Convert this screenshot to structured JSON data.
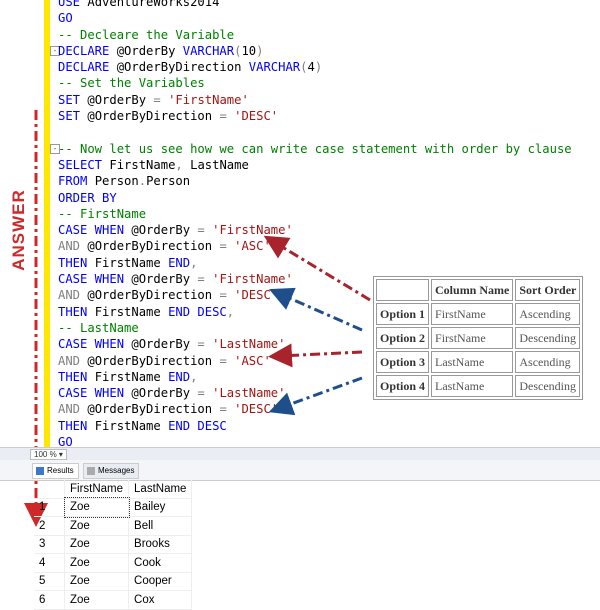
{
  "editor": {
    "lines": [
      [
        {
          "t": "USE ",
          "c": "kw"
        },
        {
          "t": "AdventureWorks2014",
          "c": "id"
        }
      ],
      [
        {
          "t": "GO",
          "c": "kw"
        }
      ],
      [
        {
          "t": "-- Decleare the Variable",
          "c": "cm"
        }
      ],
      [
        {
          "t": "DECLARE ",
          "c": "kw"
        },
        {
          "t": "@OrderBy ",
          "c": "id"
        },
        {
          "t": "VARCHAR",
          "c": "kw"
        },
        {
          "t": "(",
          "c": "op"
        },
        {
          "t": "10",
          "c": "id"
        },
        {
          "t": ")",
          "c": "op"
        }
      ],
      [
        {
          "t": "DECLARE ",
          "c": "kw"
        },
        {
          "t": "@OrderByDirection ",
          "c": "id"
        },
        {
          "t": "VARCHAR",
          "c": "kw"
        },
        {
          "t": "(",
          "c": "op"
        },
        {
          "t": "4",
          "c": "id"
        },
        {
          "t": ")",
          "c": "op"
        }
      ],
      [
        {
          "t": "-- Set the Variables",
          "c": "cm"
        }
      ],
      [
        {
          "t": "SET ",
          "c": "kw"
        },
        {
          "t": "@OrderBy ",
          "c": "id"
        },
        {
          "t": "= ",
          "c": "op"
        },
        {
          "t": "'FirstName'",
          "c": "str"
        }
      ],
      [
        {
          "t": "SET ",
          "c": "kw"
        },
        {
          "t": "@OrderByDirection ",
          "c": "id"
        },
        {
          "t": "= ",
          "c": "op"
        },
        {
          "t": "'DESC'",
          "c": "str"
        }
      ],
      [],
      [
        {
          "t": "-- Now let us see how we can write case statement with order by clause",
          "c": "cm"
        }
      ],
      [
        {
          "t": "SELECT ",
          "c": "kw"
        },
        {
          "t": "FirstName",
          "c": "id"
        },
        {
          "t": ", ",
          "c": "op"
        },
        {
          "t": "LastName",
          "c": "id"
        }
      ],
      [
        {
          "t": "FROM ",
          "c": "kw"
        },
        {
          "t": "Person",
          "c": "id"
        },
        {
          "t": ".",
          "c": "op"
        },
        {
          "t": "Person",
          "c": "id"
        }
      ],
      [
        {
          "t": "ORDER BY",
          "c": "kw"
        }
      ],
      [
        {
          "t": "-- FirstName",
          "c": "cm"
        }
      ],
      [
        {
          "t": "CASE WHEN ",
          "c": "kw"
        },
        {
          "t": "@OrderBy ",
          "c": "id"
        },
        {
          "t": "= ",
          "c": "op"
        },
        {
          "t": "'FirstName'",
          "c": "str"
        }
      ],
      [
        {
          "t": "AND ",
          "c": "op"
        },
        {
          "t": "@OrderByDirection ",
          "c": "id"
        },
        {
          "t": "= ",
          "c": "op"
        },
        {
          "t": "'ASC'",
          "c": "str"
        }
      ],
      [
        {
          "t": "THEN ",
          "c": "kw"
        },
        {
          "t": "FirstName ",
          "c": "id"
        },
        {
          "t": "END",
          "c": "kw"
        },
        {
          "t": ",",
          "c": "op"
        }
      ],
      [
        {
          "t": "CASE WHEN ",
          "c": "kw"
        },
        {
          "t": "@OrderBy ",
          "c": "id"
        },
        {
          "t": "= ",
          "c": "op"
        },
        {
          "t": "'FirstName'",
          "c": "str"
        }
      ],
      [
        {
          "t": "AND ",
          "c": "op"
        },
        {
          "t": "@OrderByDirection ",
          "c": "id"
        },
        {
          "t": "= ",
          "c": "op"
        },
        {
          "t": "'DESC'",
          "c": "str"
        }
      ],
      [
        {
          "t": "THEN ",
          "c": "kw"
        },
        {
          "t": "FirstName ",
          "c": "id"
        },
        {
          "t": "END DESC",
          "c": "kw"
        },
        {
          "t": ",",
          "c": "op"
        }
      ],
      [
        {
          "t": "-- LastName",
          "c": "cm"
        }
      ],
      [
        {
          "t": "CASE WHEN ",
          "c": "kw"
        },
        {
          "t": "@OrderBy ",
          "c": "id"
        },
        {
          "t": "= ",
          "c": "op"
        },
        {
          "t": "'LastName'",
          "c": "str"
        }
      ],
      [
        {
          "t": "AND ",
          "c": "op"
        },
        {
          "t": "@OrderByDirection ",
          "c": "id"
        },
        {
          "t": "= ",
          "c": "op"
        },
        {
          "t": "'ASC'",
          "c": "str"
        }
      ],
      [
        {
          "t": "THEN ",
          "c": "kw"
        },
        {
          "t": "FirstName ",
          "c": "id"
        },
        {
          "t": "END",
          "c": "kw"
        },
        {
          "t": ",",
          "c": "op"
        }
      ],
      [
        {
          "t": "CASE WHEN ",
          "c": "kw"
        },
        {
          "t": "@OrderBy ",
          "c": "id"
        },
        {
          "t": "= ",
          "c": "op"
        },
        {
          "t": "'LastName'",
          "c": "str"
        }
      ],
      [
        {
          "t": "AND ",
          "c": "op"
        },
        {
          "t": "@OrderByDirection ",
          "c": "id"
        },
        {
          "t": "= ",
          "c": "op"
        },
        {
          "t": "'DESC'",
          "c": "str"
        }
      ],
      [
        {
          "t": "THEN ",
          "c": "kw"
        },
        {
          "t": "FirstName ",
          "c": "id"
        },
        {
          "t": "END DESC",
          "c": "kw"
        }
      ],
      [
        {
          "t": "GO",
          "c": "kw"
        }
      ]
    ]
  },
  "annotation": {
    "answer_label": "ANSWER",
    "colors": {
      "red_arrow": "#a8232b",
      "blue_arrow": "#1f4f8a"
    }
  },
  "options_table": {
    "headers": [
      "",
      "Column Name",
      "Sort Order"
    ],
    "rows": [
      [
        "Option 1",
        "FirstName",
        "Ascending"
      ],
      [
        "Option 2",
        "FirstName",
        "Descending"
      ],
      [
        "Option 3",
        "LastName",
        "Ascending"
      ],
      [
        "Option 4",
        "LastName",
        "Descending"
      ]
    ]
  },
  "statusbar": {
    "zoom": "100 %"
  },
  "tabs": {
    "results": "Results",
    "messages": "Messages"
  },
  "results": {
    "columns": [
      "FirstName",
      "LastName"
    ],
    "rows": [
      [
        "1",
        "Zoe",
        "Bailey"
      ],
      [
        "2",
        "Zoe",
        "Bell"
      ],
      [
        "3",
        "Zoe",
        "Brooks"
      ],
      [
        "4",
        "Zoe",
        "Cook"
      ],
      [
        "5",
        "Zoe",
        "Cooper"
      ],
      [
        "6",
        "Zoe",
        "Cox"
      ]
    ]
  }
}
